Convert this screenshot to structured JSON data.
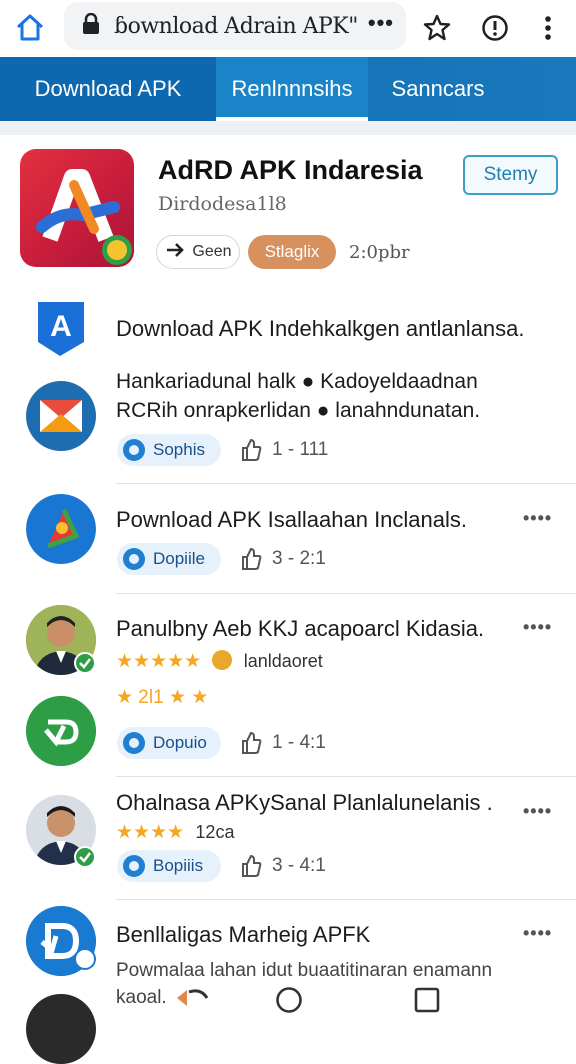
{
  "browser": {
    "url": "ɓownload Adrain APK\"",
    "url_more": "•••"
  },
  "tabs": [
    {
      "label": "Download APK"
    },
    {
      "label": "Renlnnnsihs"
    },
    {
      "label": "Sanncars"
    }
  ],
  "app": {
    "title": "AdRD APK Indaresia",
    "subtitle": "Dirdodesa1l8",
    "open_label": "Stemy",
    "share_label": "Geen",
    "tag_label": "Stlaglix",
    "time": "2:0pbr"
  },
  "list": [
    {
      "title": "Download APK Indehkalkgen antlanlansa.",
      "icon": "letter-a-logo"
    },
    {
      "line1": "Hankariadunal halk ● Kadoyeldaadnan",
      "line2": "RCRih onrapkerlidan ● lanahndunatan.",
      "pill": "Sophis",
      "count": "1 - 111",
      "icon": "envelope-app-icon"
    },
    {
      "title": "Pownload APK Isallaahan Inclanals.",
      "pill": "Dopiile",
      "count": "3 - 2:1",
      "more": "••••",
      "icon": "play-triangle-icon"
    },
    {
      "title": "Panulbny Aeb KKJ acapoarcl Kidasia.",
      "stars": "★★★★★",
      "stars_text": "lanldaoret",
      "stars2": "★ 2l1 ★ ★",
      "more": "••••",
      "icon": "person-avatar"
    },
    {
      "pill": "Dopuio",
      "count": "1 - 4:1",
      "icon": "green-refresh-icon"
    },
    {
      "title": "Ohalnasa APKySanal Planlalunelanis .",
      "stars": "★★★★",
      "stars_text": "12ca",
      "pill": "Bopiiis",
      "count": "3 - 4:1",
      "more": "••••",
      "icon": "person-avatar"
    },
    {
      "title": "Benllaligas Marheig APFK",
      "line1": "Powmalaa lahan idut buaatitinaran enamann",
      "line2": "kaoal.",
      "more": "••••",
      "icon": "blue-d-logo"
    }
  ],
  "colors": {
    "tab_bar": "#0f6fb5",
    "accent": "#1f7fd1",
    "tag": "#d7915e",
    "star": "#f5a623"
  }
}
